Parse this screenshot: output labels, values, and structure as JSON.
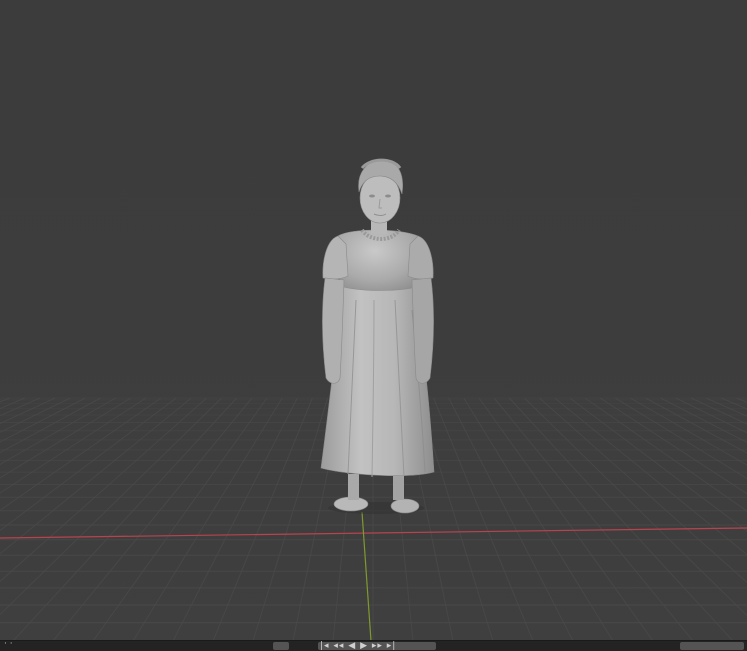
{
  "viewport": {
    "name": "3D Viewport",
    "model": "figure-statue",
    "grid": true,
    "axes": {
      "x_color": "#b8434f",
      "y_color": "#7f9a2c"
    }
  },
  "timeline": {
    "left_label": "· ·",
    "playback_glyphs": "|◂ ◂◂ ◀ ▶ ▸▸ ▸|",
    "record_icon": "record-icon"
  }
}
